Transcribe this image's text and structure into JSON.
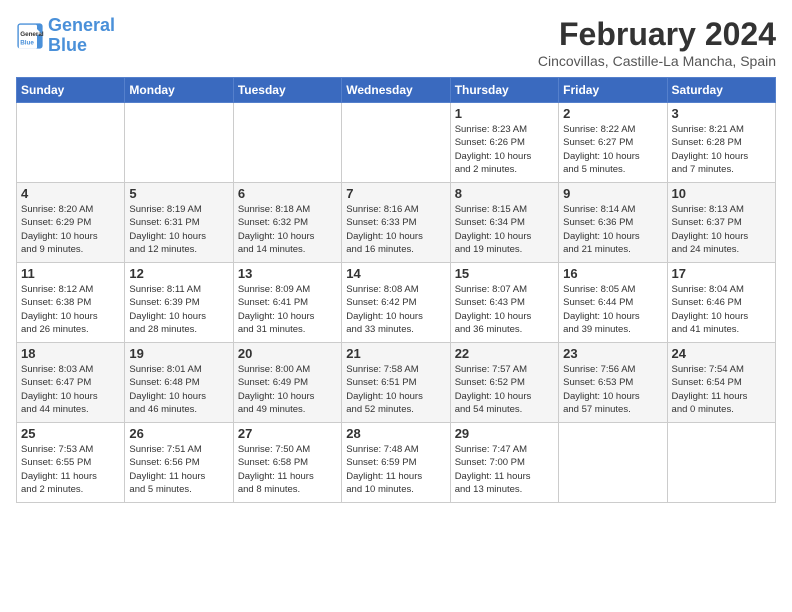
{
  "logo": {
    "line1": "General",
    "line2": "Blue"
  },
  "title": "February 2024",
  "location": "Cincovillas, Castille-La Mancha, Spain",
  "weekdays": [
    "Sunday",
    "Monday",
    "Tuesday",
    "Wednesday",
    "Thursday",
    "Friday",
    "Saturday"
  ],
  "weeks": [
    [
      {
        "day": "",
        "info": ""
      },
      {
        "day": "",
        "info": ""
      },
      {
        "day": "",
        "info": ""
      },
      {
        "day": "",
        "info": ""
      },
      {
        "day": "1",
        "info": "Sunrise: 8:23 AM\nSunset: 6:26 PM\nDaylight: 10 hours\nand 2 minutes."
      },
      {
        "day": "2",
        "info": "Sunrise: 8:22 AM\nSunset: 6:27 PM\nDaylight: 10 hours\nand 5 minutes."
      },
      {
        "day": "3",
        "info": "Sunrise: 8:21 AM\nSunset: 6:28 PM\nDaylight: 10 hours\nand 7 minutes."
      }
    ],
    [
      {
        "day": "4",
        "info": "Sunrise: 8:20 AM\nSunset: 6:29 PM\nDaylight: 10 hours\nand 9 minutes."
      },
      {
        "day": "5",
        "info": "Sunrise: 8:19 AM\nSunset: 6:31 PM\nDaylight: 10 hours\nand 12 minutes."
      },
      {
        "day": "6",
        "info": "Sunrise: 8:18 AM\nSunset: 6:32 PM\nDaylight: 10 hours\nand 14 minutes."
      },
      {
        "day": "7",
        "info": "Sunrise: 8:16 AM\nSunset: 6:33 PM\nDaylight: 10 hours\nand 16 minutes."
      },
      {
        "day": "8",
        "info": "Sunrise: 8:15 AM\nSunset: 6:34 PM\nDaylight: 10 hours\nand 19 minutes."
      },
      {
        "day": "9",
        "info": "Sunrise: 8:14 AM\nSunset: 6:36 PM\nDaylight: 10 hours\nand 21 minutes."
      },
      {
        "day": "10",
        "info": "Sunrise: 8:13 AM\nSunset: 6:37 PM\nDaylight: 10 hours\nand 24 minutes."
      }
    ],
    [
      {
        "day": "11",
        "info": "Sunrise: 8:12 AM\nSunset: 6:38 PM\nDaylight: 10 hours\nand 26 minutes."
      },
      {
        "day": "12",
        "info": "Sunrise: 8:11 AM\nSunset: 6:39 PM\nDaylight: 10 hours\nand 28 minutes."
      },
      {
        "day": "13",
        "info": "Sunrise: 8:09 AM\nSunset: 6:41 PM\nDaylight: 10 hours\nand 31 minutes."
      },
      {
        "day": "14",
        "info": "Sunrise: 8:08 AM\nSunset: 6:42 PM\nDaylight: 10 hours\nand 33 minutes."
      },
      {
        "day": "15",
        "info": "Sunrise: 8:07 AM\nSunset: 6:43 PM\nDaylight: 10 hours\nand 36 minutes."
      },
      {
        "day": "16",
        "info": "Sunrise: 8:05 AM\nSunset: 6:44 PM\nDaylight: 10 hours\nand 39 minutes."
      },
      {
        "day": "17",
        "info": "Sunrise: 8:04 AM\nSunset: 6:46 PM\nDaylight: 10 hours\nand 41 minutes."
      }
    ],
    [
      {
        "day": "18",
        "info": "Sunrise: 8:03 AM\nSunset: 6:47 PM\nDaylight: 10 hours\nand 44 minutes."
      },
      {
        "day": "19",
        "info": "Sunrise: 8:01 AM\nSunset: 6:48 PM\nDaylight: 10 hours\nand 46 minutes."
      },
      {
        "day": "20",
        "info": "Sunrise: 8:00 AM\nSunset: 6:49 PM\nDaylight: 10 hours\nand 49 minutes."
      },
      {
        "day": "21",
        "info": "Sunrise: 7:58 AM\nSunset: 6:51 PM\nDaylight: 10 hours\nand 52 minutes."
      },
      {
        "day": "22",
        "info": "Sunrise: 7:57 AM\nSunset: 6:52 PM\nDaylight: 10 hours\nand 54 minutes."
      },
      {
        "day": "23",
        "info": "Sunrise: 7:56 AM\nSunset: 6:53 PM\nDaylight: 10 hours\nand 57 minutes."
      },
      {
        "day": "24",
        "info": "Sunrise: 7:54 AM\nSunset: 6:54 PM\nDaylight: 11 hours\nand 0 minutes."
      }
    ],
    [
      {
        "day": "25",
        "info": "Sunrise: 7:53 AM\nSunset: 6:55 PM\nDaylight: 11 hours\nand 2 minutes."
      },
      {
        "day": "26",
        "info": "Sunrise: 7:51 AM\nSunset: 6:56 PM\nDaylight: 11 hours\nand 5 minutes."
      },
      {
        "day": "27",
        "info": "Sunrise: 7:50 AM\nSunset: 6:58 PM\nDaylight: 11 hours\nand 8 minutes."
      },
      {
        "day": "28",
        "info": "Sunrise: 7:48 AM\nSunset: 6:59 PM\nDaylight: 11 hours\nand 10 minutes."
      },
      {
        "day": "29",
        "info": "Sunrise: 7:47 AM\nSunset: 7:00 PM\nDaylight: 11 hours\nand 13 minutes."
      },
      {
        "day": "",
        "info": ""
      },
      {
        "day": "",
        "info": ""
      }
    ]
  ]
}
